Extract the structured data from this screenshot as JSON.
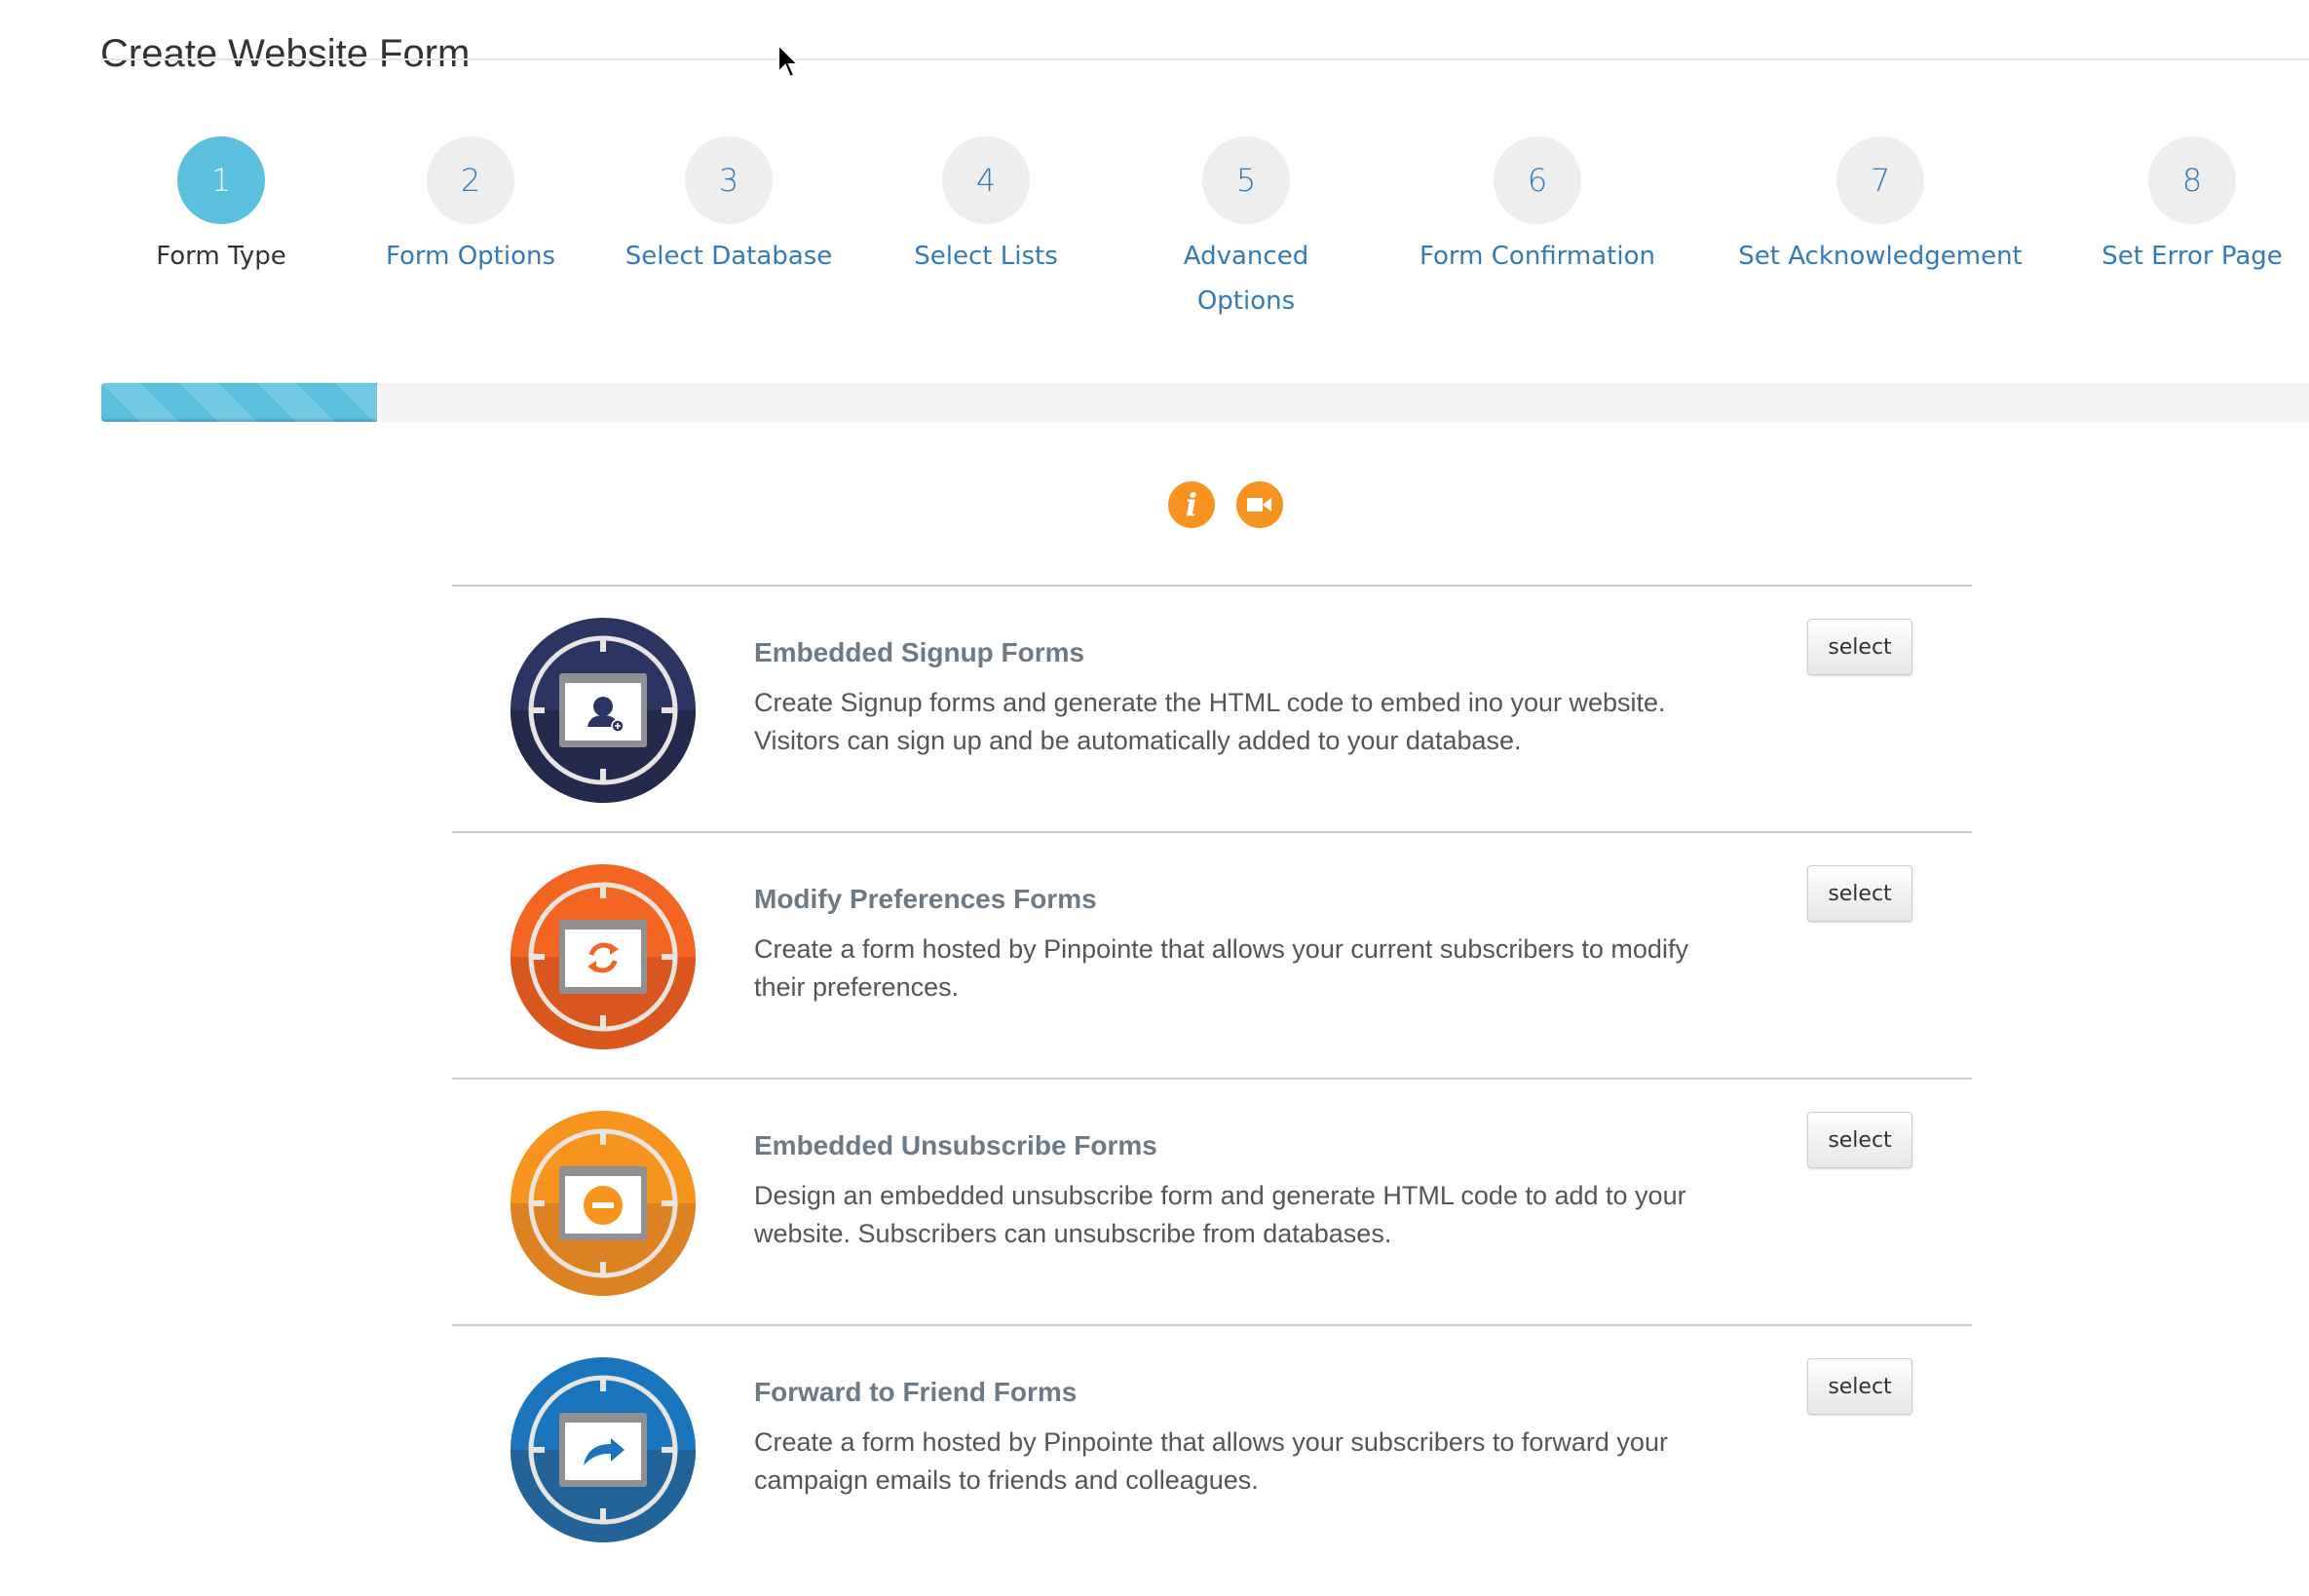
{
  "page": {
    "title": "Create Website Form"
  },
  "wizard": {
    "current_step": 1,
    "total_steps": 8,
    "progress_fraction": 0.125,
    "steps": [
      {
        "number": "1",
        "label": "Form Type",
        "active": true
      },
      {
        "number": "2",
        "label": "Form Options",
        "active": false
      },
      {
        "number": "3",
        "label": "Select Database",
        "active": false
      },
      {
        "number": "4",
        "label": "Select Lists",
        "active": false
      },
      {
        "number": "5",
        "label": "Advanced Options",
        "active": false
      },
      {
        "number": "6",
        "label": "Form Confirmation",
        "active": false
      },
      {
        "number": "7",
        "label": "Set Acknowledgement",
        "active": false
      },
      {
        "number": "8",
        "label": "Set Error Page",
        "active": false
      }
    ]
  },
  "help": {
    "info_icon": "info-icon",
    "video_icon": "video-camera-icon",
    "color": "#f7931e"
  },
  "forms": [
    {
      "title": "Embedded Signup Forms",
      "description": "Create Signup forms and generate the HTML code to embed ino your website. Visitors can sign up and be automatically added to your database.",
      "icon": "add-user-icon",
      "color": "#283057",
      "select_label": "select"
    },
    {
      "title": "Modify Preferences Forms",
      "description": "Create a form hosted by Pinpointe that allows your current subscribers to modify their preferences.",
      "icon": "refresh-icon",
      "color": "#f26522",
      "select_label": "select"
    },
    {
      "title": "Embedded Unsubscribe Forms",
      "description": "Design an embedded unsubscribe form and generate HTML code to add to your website. Subscribers can unsubscribe from databases.",
      "icon": "minus-circle-icon",
      "color": "#f7941d",
      "select_label": "select"
    },
    {
      "title": "Forward to Friend Forms",
      "description": "Create a form hosted by Pinpointe that allows your subscribers to forward your campaign emails to friends and colleagues.",
      "icon": "share-forward-icon",
      "color": "#1b75bc",
      "select_label": "select"
    }
  ],
  "colors": {
    "step_active": "#5bc0de",
    "step_inactive_bg": "#eeeeee",
    "link": "#337ab7"
  }
}
